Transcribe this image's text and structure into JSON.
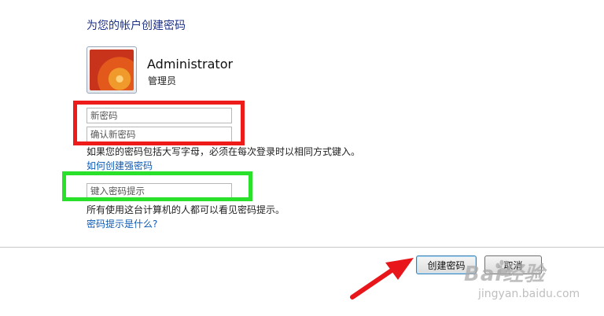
{
  "header": {
    "title": "为您的帐户创建密码"
  },
  "user": {
    "name": "Administrator",
    "role": "管理员"
  },
  "form": {
    "new_password_placeholder": "新密码",
    "confirm_password_placeholder": "确认新密码",
    "case_note": "如果您的密码包括大写字母，必须在每次登录时以相同方式键入。",
    "strong_password_link": "如何创建强密码",
    "hint_placeholder": "键入密码提示",
    "hint_note": "所有使用这台计算机的人都可以看见密码提示。",
    "hint_help_link": "密码提示是什么?"
  },
  "buttons": {
    "create_label": "创建密码",
    "cancel_label": "取消"
  },
  "annotations": {
    "red_box_color": "#ee1b1b",
    "green_box_color": "#29e02a",
    "arrow_color": "#e8151b",
    "icons": [
      "user-avatar-flower",
      "red-arrow-icon",
      "baidu-paw-icon"
    ]
  },
  "watermark": {
    "main": "Bai经验",
    "sub": "jingyan.baidu.com"
  }
}
